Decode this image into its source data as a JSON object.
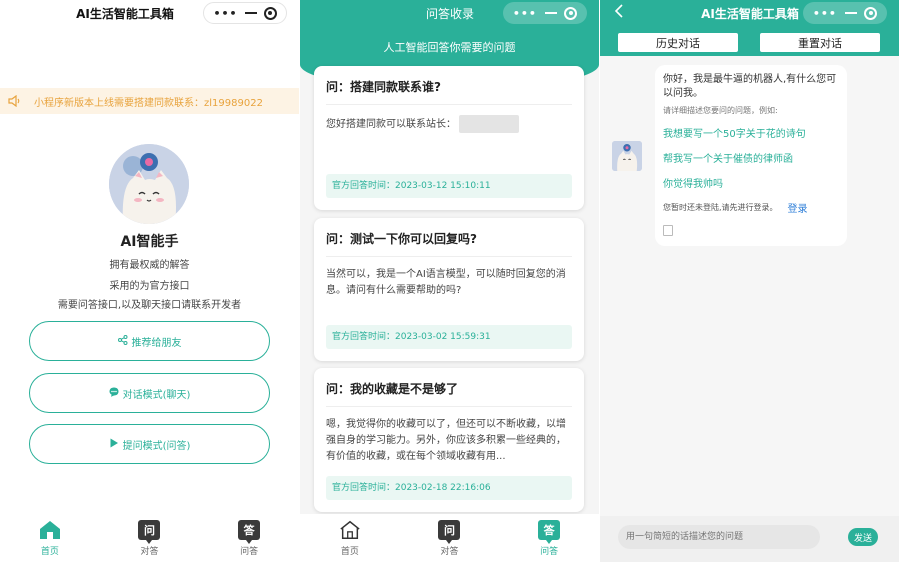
{
  "colors": {
    "accent": "#2ab099",
    "notice_bg": "#fdf3e4",
    "notice_text": "#e8a33d",
    "login_link": "#2f7fd8"
  },
  "home": {
    "title": "AI生活智能工具箱",
    "notice": "小程序新版本上线需要搭建同款联系：zl19989022",
    "name": "AI智能手",
    "desc": [
      "拥有最权威的解答",
      "采用的为官方接口",
      "需要问答接口,以及聊天接口请联系开发者"
    ],
    "buttons": [
      {
        "icon": "share-icon",
        "label": "推荐给朋友"
      },
      {
        "icon": "chat-icon",
        "label": "对话模式(聊天)"
      },
      {
        "icon": "play-icon",
        "label": "提问模式(问答)"
      }
    ],
    "tabs": [
      {
        "icon": "home-icon",
        "label": "首页",
        "active": true
      },
      {
        "icon": "ask-icon",
        "glyph": "问",
        "label": "对答",
        "active": false
      },
      {
        "icon": "answer-icon",
        "glyph": "答",
        "label": "问答",
        "active": false
      }
    ]
  },
  "qa": {
    "title": "问答收录",
    "subtitle": "人工智能回答你需要的问题",
    "items": [
      {
        "q": "问：搭建同款联系谁?",
        "a": "您好搭建同款可以联系站长：",
        "time": "官方回答时间：2023-03-12 15:10:11"
      },
      {
        "q": "问：测试一下你可以回复吗?",
        "a": "当然可以，我是一个AI语言模型，可以随时回复您的消息。请问有什么需要帮助的吗?",
        "time": "官方回答时间：2023-03-02 15:59:31"
      },
      {
        "q": "问：我的收藏是不是够了",
        "a": "嗯，我觉得你的收藏可以了，但还可以不断收藏，以增强自身的学习能力。另外，你应该多积累一些经典的，有价值的收藏，或在每个领域收藏有用...",
        "time": "官方回答时间：2023-02-18 22:16:06"
      }
    ],
    "tabs": [
      {
        "icon": "home-icon",
        "label": "首页",
        "active": false
      },
      {
        "icon": "ask-icon",
        "glyph": "问",
        "label": "对答",
        "active": false
      },
      {
        "icon": "answer-icon",
        "glyph": "答",
        "label": "问答",
        "active": true
      }
    ]
  },
  "chat": {
    "title": "AI生活智能工具箱",
    "history_btn": "历史对话",
    "reset_btn": "重置对话",
    "greeting": "你好，我是最牛逼的机器人,有什么您可以问我。",
    "hint": "请详细描述您要问的问题，例如:",
    "examples": [
      "我想要写一个50字关于花的诗句",
      "帮我写一个关于催债的律师函",
      "你觉得我帅吗"
    ],
    "login_notice": "您暂时还未登陆,请先进行登录。",
    "login_link": "登录",
    "input_placeholder": "用一句简短的话描述您的问题",
    "send": "发送"
  }
}
